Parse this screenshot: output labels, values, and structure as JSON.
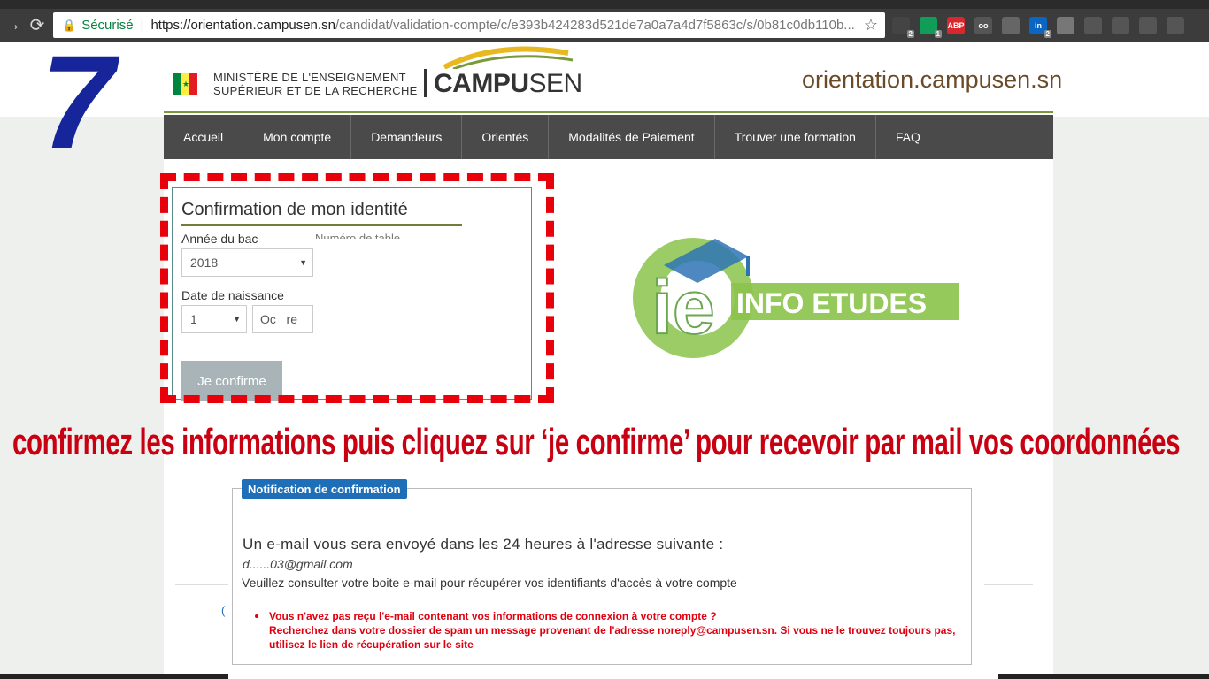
{
  "browser": {
    "secure_label": "Sécurisé",
    "url_host": "https://orientation.campusen.sn",
    "url_path": "/candidat/validation-compte/c/e393b424283d521de7a0a7a4d7f5863c/s/0b81c0db110b...",
    "extensions": [
      {
        "name": "gmail-icon",
        "label": "",
        "color": "#444444",
        "badge": "2"
      },
      {
        "name": "hangouts-icon",
        "label": "",
        "color": "#0f9d58",
        "badge": "1"
      },
      {
        "name": "adblock-icon",
        "label": "ABP",
        "color": "#d9272e"
      },
      {
        "name": "reader-icon",
        "label": "oo",
        "color": "#555555"
      },
      {
        "name": "pdf-icon",
        "label": "",
        "color": "#666666"
      },
      {
        "name": "linkedin-icon",
        "label": "in",
        "color": "#0a66c2",
        "badge": "2"
      },
      {
        "name": "drive-icon",
        "label": "",
        "color": "#777777"
      },
      {
        "name": "vpn-icon",
        "label": "",
        "color": "#555555"
      },
      {
        "name": "cube-icon",
        "label": "",
        "color": "#555555"
      },
      {
        "name": "shield-icon",
        "label": "",
        "color": "#555555"
      },
      {
        "name": "mail-icon",
        "label": "",
        "color": "#555555"
      }
    ]
  },
  "header": {
    "ministry_line1": "MINISTÈRE DE L'ENSEIGNEMENT",
    "ministry_line2": "SUPÉRIEUR ET DE LA RECHERCHE",
    "logo_bold": "CAMPU",
    "logo_thin": "SEN",
    "domain": "orientation.campusen.sn"
  },
  "menu": {
    "items": [
      "Accueil",
      "Mon compte",
      "Demandeurs",
      "Orientés",
      "Modalités de Paiement",
      "Trouver une formation",
      "FAQ"
    ]
  },
  "overlay": {
    "step_number": "7",
    "instruction": "confirmez les informations puis cliquez sur ‘je confirme’ pour recevoir par mail vos coordonnées",
    "watermark": "INFO ETUDES",
    "watermark_letters": "ie"
  },
  "form": {
    "title": "Confirmation de mon identité",
    "bac_year_label": "Année du bac",
    "bac_year_value": "2018",
    "table_number_label": "Numéro de table",
    "birth_date_label": "Date de naissance",
    "birth_day_value": "1",
    "birth_month_value": "Oc   re",
    "confirm_label": "Je confirme"
  },
  "notification": {
    "tag": "Notification de confirmation",
    "main_text": "Un e-mail vous sera envoyé dans les 24 heures à l'adresse suivante :",
    "email": "d......03@gmail.com",
    "sub_text": "Veuillez consulter votre boite e-mail pour récupérer vos identifiants d'accès à votre compte",
    "warn_line1": "Vous n'avez pas reçu l'e-mail contenant vos informations de connexion à votre compte ?",
    "warn_line2": "Recherchez dans votre dossier de spam un message provenant de l'adresse noreply@campusen.sn. Si vous ne le trouvez toujours pas, utilisez le lien de récupération sur le site",
    "blue_fragment": "("
  },
  "colors": {
    "menu_bg": "#4a4a4a",
    "accent_green": "#7a9a3a",
    "banner_red": "#c80012",
    "notif_blue": "#1f6fb8",
    "step_blue": "#16259a"
  }
}
